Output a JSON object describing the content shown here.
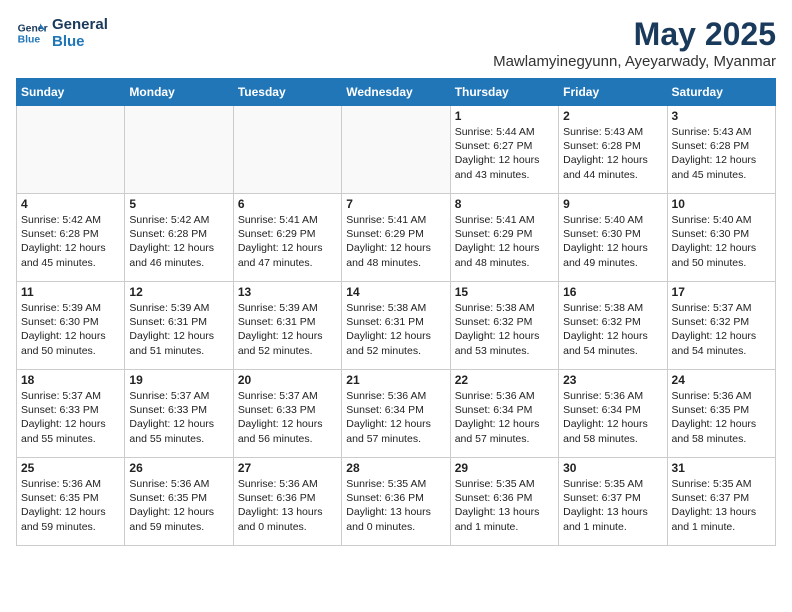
{
  "logo": {
    "line1": "General",
    "line2": "Blue"
  },
  "title": "May 2025",
  "subtitle": "Mawlamyinegyunn, Ayeyarwady, Myanmar",
  "header_days": [
    "Sunday",
    "Monday",
    "Tuesday",
    "Wednesday",
    "Thursday",
    "Friday",
    "Saturday"
  ],
  "weeks": [
    [
      {
        "day": "",
        "info": ""
      },
      {
        "day": "",
        "info": ""
      },
      {
        "day": "",
        "info": ""
      },
      {
        "day": "",
        "info": ""
      },
      {
        "day": "1",
        "info": "Sunrise: 5:44 AM\nSunset: 6:27 PM\nDaylight: 12 hours\nand 43 minutes."
      },
      {
        "day": "2",
        "info": "Sunrise: 5:43 AM\nSunset: 6:28 PM\nDaylight: 12 hours\nand 44 minutes."
      },
      {
        "day": "3",
        "info": "Sunrise: 5:43 AM\nSunset: 6:28 PM\nDaylight: 12 hours\nand 45 minutes."
      }
    ],
    [
      {
        "day": "4",
        "info": "Sunrise: 5:42 AM\nSunset: 6:28 PM\nDaylight: 12 hours\nand 45 minutes."
      },
      {
        "day": "5",
        "info": "Sunrise: 5:42 AM\nSunset: 6:28 PM\nDaylight: 12 hours\nand 46 minutes."
      },
      {
        "day": "6",
        "info": "Sunrise: 5:41 AM\nSunset: 6:29 PM\nDaylight: 12 hours\nand 47 minutes."
      },
      {
        "day": "7",
        "info": "Sunrise: 5:41 AM\nSunset: 6:29 PM\nDaylight: 12 hours\nand 48 minutes."
      },
      {
        "day": "8",
        "info": "Sunrise: 5:41 AM\nSunset: 6:29 PM\nDaylight: 12 hours\nand 48 minutes."
      },
      {
        "day": "9",
        "info": "Sunrise: 5:40 AM\nSunset: 6:30 PM\nDaylight: 12 hours\nand 49 minutes."
      },
      {
        "day": "10",
        "info": "Sunrise: 5:40 AM\nSunset: 6:30 PM\nDaylight: 12 hours\nand 50 minutes."
      }
    ],
    [
      {
        "day": "11",
        "info": "Sunrise: 5:39 AM\nSunset: 6:30 PM\nDaylight: 12 hours\nand 50 minutes."
      },
      {
        "day": "12",
        "info": "Sunrise: 5:39 AM\nSunset: 6:31 PM\nDaylight: 12 hours\nand 51 minutes."
      },
      {
        "day": "13",
        "info": "Sunrise: 5:39 AM\nSunset: 6:31 PM\nDaylight: 12 hours\nand 52 minutes."
      },
      {
        "day": "14",
        "info": "Sunrise: 5:38 AM\nSunset: 6:31 PM\nDaylight: 12 hours\nand 52 minutes."
      },
      {
        "day": "15",
        "info": "Sunrise: 5:38 AM\nSunset: 6:32 PM\nDaylight: 12 hours\nand 53 minutes."
      },
      {
        "day": "16",
        "info": "Sunrise: 5:38 AM\nSunset: 6:32 PM\nDaylight: 12 hours\nand 54 minutes."
      },
      {
        "day": "17",
        "info": "Sunrise: 5:37 AM\nSunset: 6:32 PM\nDaylight: 12 hours\nand 54 minutes."
      }
    ],
    [
      {
        "day": "18",
        "info": "Sunrise: 5:37 AM\nSunset: 6:33 PM\nDaylight: 12 hours\nand 55 minutes."
      },
      {
        "day": "19",
        "info": "Sunrise: 5:37 AM\nSunset: 6:33 PM\nDaylight: 12 hours\nand 55 minutes."
      },
      {
        "day": "20",
        "info": "Sunrise: 5:37 AM\nSunset: 6:33 PM\nDaylight: 12 hours\nand 56 minutes."
      },
      {
        "day": "21",
        "info": "Sunrise: 5:36 AM\nSunset: 6:34 PM\nDaylight: 12 hours\nand 57 minutes."
      },
      {
        "day": "22",
        "info": "Sunrise: 5:36 AM\nSunset: 6:34 PM\nDaylight: 12 hours\nand 57 minutes."
      },
      {
        "day": "23",
        "info": "Sunrise: 5:36 AM\nSunset: 6:34 PM\nDaylight: 12 hours\nand 58 minutes."
      },
      {
        "day": "24",
        "info": "Sunrise: 5:36 AM\nSunset: 6:35 PM\nDaylight: 12 hours\nand 58 minutes."
      }
    ],
    [
      {
        "day": "25",
        "info": "Sunrise: 5:36 AM\nSunset: 6:35 PM\nDaylight: 12 hours\nand 59 minutes."
      },
      {
        "day": "26",
        "info": "Sunrise: 5:36 AM\nSunset: 6:35 PM\nDaylight: 12 hours\nand 59 minutes."
      },
      {
        "day": "27",
        "info": "Sunrise: 5:36 AM\nSunset: 6:36 PM\nDaylight: 13 hours\nand 0 minutes."
      },
      {
        "day": "28",
        "info": "Sunrise: 5:35 AM\nSunset: 6:36 PM\nDaylight: 13 hours\nand 0 minutes."
      },
      {
        "day": "29",
        "info": "Sunrise: 5:35 AM\nSunset: 6:36 PM\nDaylight: 13 hours\nand 1 minute."
      },
      {
        "day": "30",
        "info": "Sunrise: 5:35 AM\nSunset: 6:37 PM\nDaylight: 13 hours\nand 1 minute."
      },
      {
        "day": "31",
        "info": "Sunrise: 5:35 AM\nSunset: 6:37 PM\nDaylight: 13 hours\nand 1 minute."
      }
    ]
  ]
}
